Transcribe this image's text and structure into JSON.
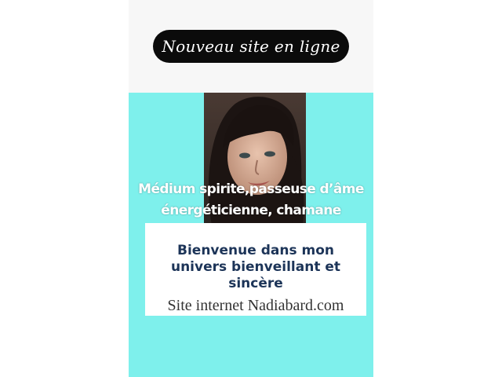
{
  "announcement": {
    "label": "Nouveau site en ligne"
  },
  "portrait": {
    "description_icon": "portrait-photo-icon"
  },
  "tagline": {
    "line1": "Médium spirite,passeuse d’âme",
    "line2": "énergéticienne, chamane"
  },
  "welcome": {
    "line1": "Bienvenue dans mon",
    "line2": "univers bienveillant et",
    "line3": "sincère"
  },
  "site": {
    "label": "Site internet Nadiabard.com"
  },
  "colors": {
    "background": "#7ef0ec",
    "top_band": "#f7f7f7",
    "pill": "#0b0b0b",
    "heading": "#1c3458"
  }
}
